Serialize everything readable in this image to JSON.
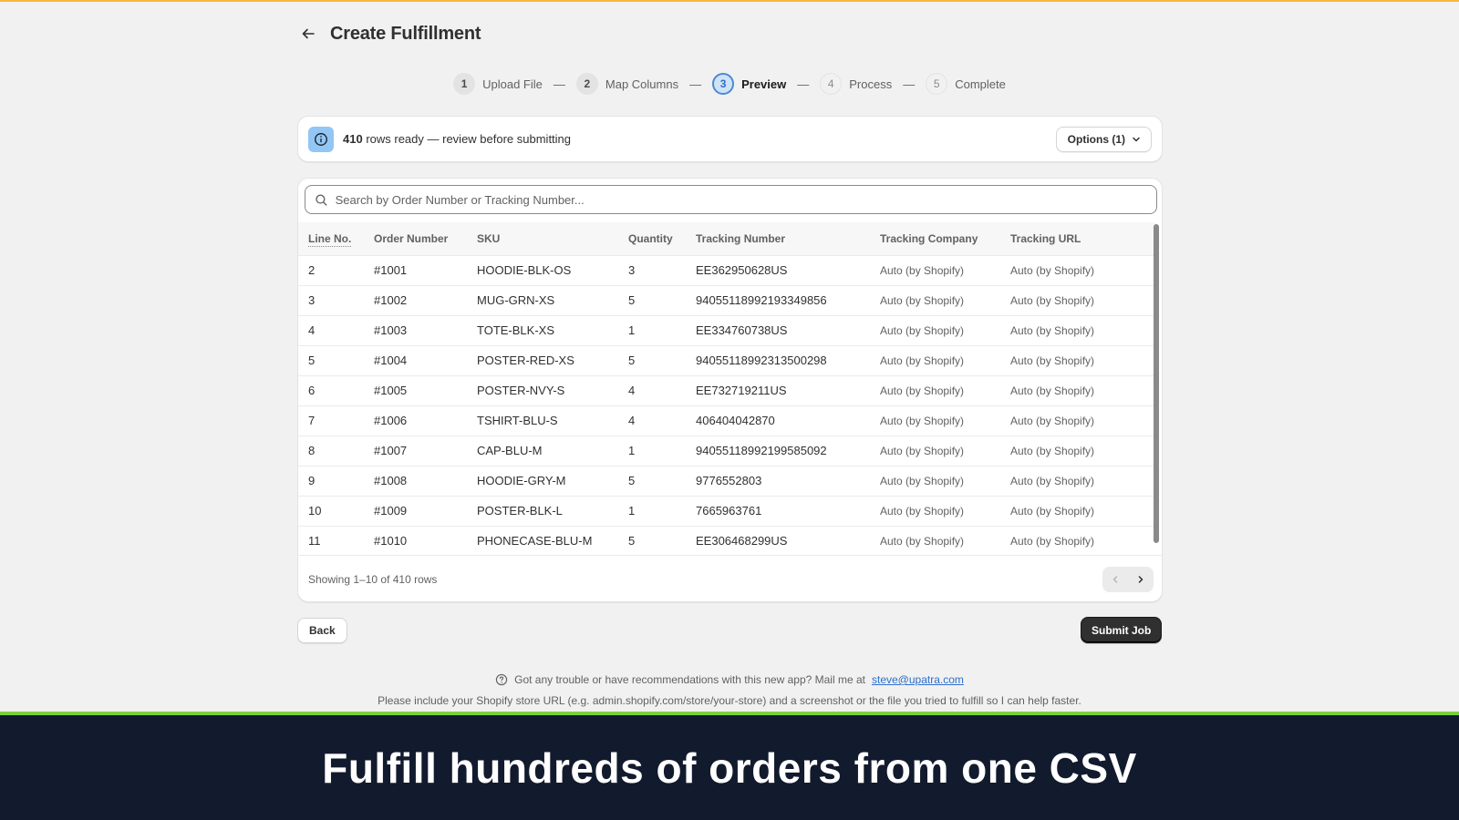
{
  "colors": {
    "top_accent": "#f5b83d",
    "active_step": "#4a8ad4",
    "info_icon_bg": "#91c6f5",
    "primary_button": "#303030",
    "link": "#2c6ecb",
    "green_bar": "#7ad03a",
    "caption_band": "#121a2e"
  },
  "header": {
    "title": "Create Fulfillment",
    "back_icon": "arrow-left-icon"
  },
  "stepper": {
    "separator": "—",
    "steps": [
      {
        "num": "1",
        "label": "Upload File",
        "state": "done"
      },
      {
        "num": "2",
        "label": "Map Columns",
        "state": "done"
      },
      {
        "num": "3",
        "label": "Preview",
        "state": "active"
      },
      {
        "num": "4",
        "label": "Process",
        "state": "pending"
      },
      {
        "num": "5",
        "label": "Complete",
        "state": "pending"
      }
    ]
  },
  "banner": {
    "icon": "info-icon",
    "count": "410",
    "text": " rows ready — review before submitting",
    "options_label": "Options (1)",
    "options_icon": "chevron-down-icon"
  },
  "search": {
    "icon": "search-icon",
    "placeholder": "Search by Order Number or Tracking Number...",
    "value": ""
  },
  "table": {
    "columns": [
      "Line No.",
      "Order Number",
      "SKU",
      "Quantity",
      "Tracking Number",
      "Tracking Company",
      "Tracking URL"
    ],
    "rows": [
      [
        "2",
        "#1001",
        "HOODIE-BLK-OS",
        "3",
        "EE362950628US",
        "Auto (by Shopify)",
        "Auto (by Shopify)"
      ],
      [
        "3",
        "#1002",
        "MUG-GRN-XS",
        "5",
        "9405511899219334985​6",
        "Auto (by Shopify)",
        "Auto (by Shopify)"
      ],
      [
        "4",
        "#1003",
        "TOTE-BLK-XS",
        "1",
        "EE334760738US",
        "Auto (by Shopify)",
        "Auto (by Shopify)"
      ],
      [
        "5",
        "#1004",
        "POSTER-RED-XS",
        "5",
        "94055118992313500298",
        "Auto (by Shopify)",
        "Auto (by Shopify)"
      ],
      [
        "6",
        "#1005",
        "POSTER-NVY-S",
        "4",
        "EE732719211US",
        "Auto (by Shopify)",
        "Auto (by Shopify)"
      ],
      [
        "7",
        "#1006",
        "TSHIRT-BLU-S",
        "4",
        "406404042870",
        "Auto (by Shopify)",
        "Auto (by Shopify)"
      ],
      [
        "8",
        "#1007",
        "CAP-BLU-M",
        "1",
        "94055118992199585092",
        "Auto (by Shopify)",
        "Auto (by Shopify)"
      ],
      [
        "9",
        "#1008",
        "HOODIE-GRY-M",
        "5",
        "9776552803",
        "Auto (by Shopify)",
        "Auto (by Shopify)"
      ],
      [
        "10",
        "#1009",
        "POSTER-BLK-L",
        "1",
        "7665963761",
        "Auto (by Shopify)",
        "Auto (by Shopify)"
      ],
      [
        "11",
        "#1010",
        "PHONECASE-BLU-M",
        "5",
        "EE306468299US",
        "Auto (by Shopify)",
        "Auto (by Shopify)"
      ]
    ],
    "footer_text": "Showing 1–10 of 410 rows",
    "prev_icon": "chevron-left-icon",
    "next_icon": "chevron-right-icon"
  },
  "actions": {
    "back_label": "Back",
    "submit_label": "Submit Job"
  },
  "help": {
    "icon": "question-circle-icon",
    "text": "Got any trouble or have recommendations with this new app? Mail me at",
    "email": "steve@upatra.com",
    "line2": "Please include your Shopify store URL (e.g. admin.shopify.com/store/your-store) and a screenshot or the file you tried to fulfill so I can help faster."
  },
  "caption": {
    "text": "Fulfill hundreds of orders from one CSV"
  }
}
